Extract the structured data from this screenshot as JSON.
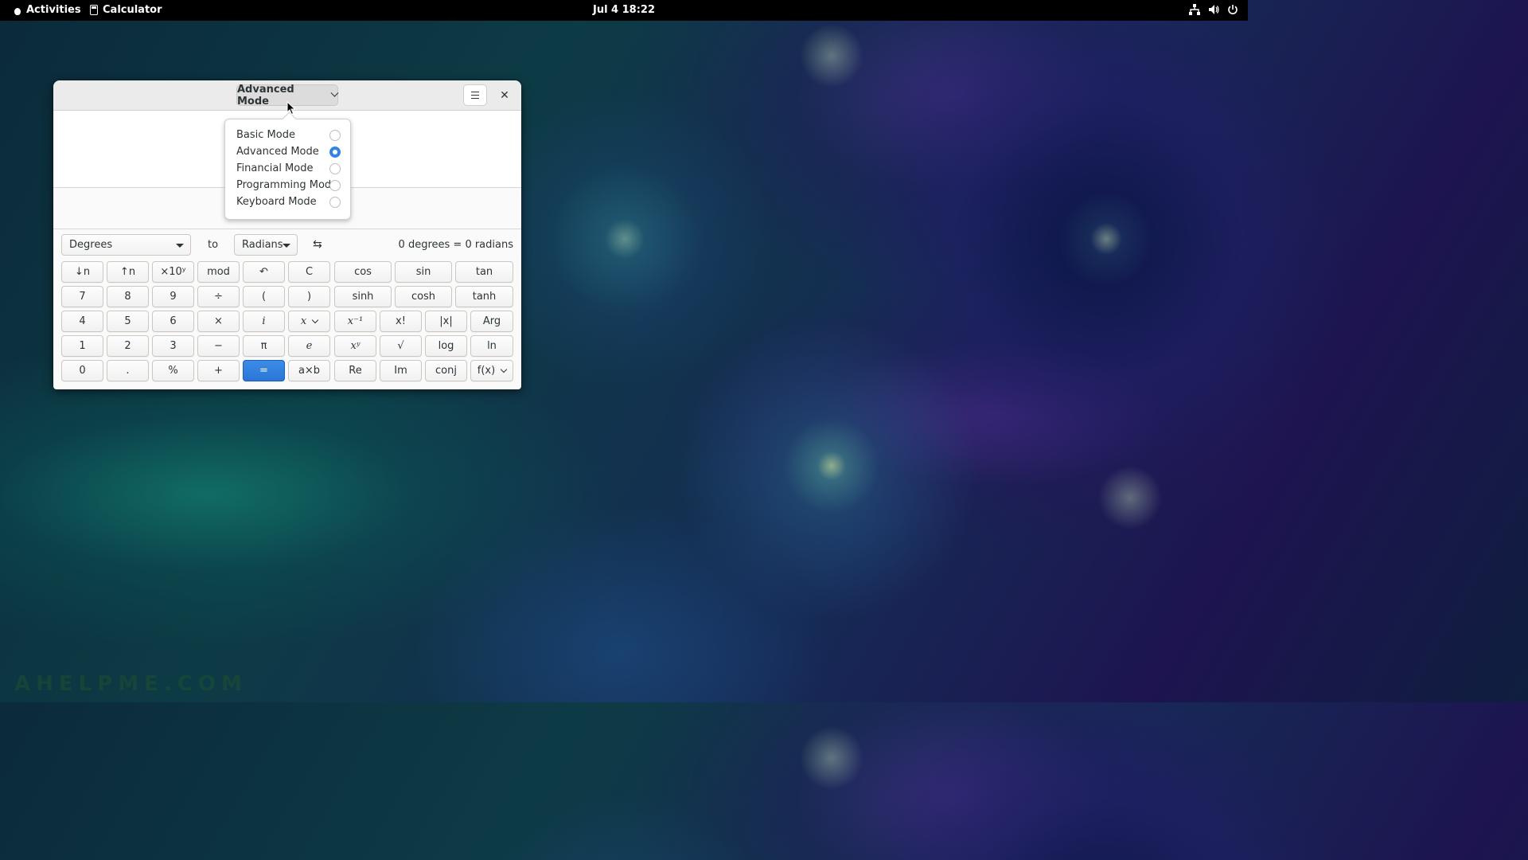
{
  "topbar": {
    "activities": "Activities",
    "app_name": "Calculator",
    "clock": "Jul 4  18:22",
    "tray_icons": [
      "network-icon",
      "volume-icon",
      "power-icon"
    ]
  },
  "window": {
    "mode_button": "Advanced Mode",
    "menu_icon": "hamburger-menu-icon",
    "close_label": "✕"
  },
  "mode_menu": {
    "items": [
      {
        "label": "Basic Mode",
        "selected": false
      },
      {
        "label": "Advanced Mode",
        "selected": true
      },
      {
        "label": "Financial Mode",
        "selected": false
      },
      {
        "label": "Programming Mode",
        "selected": false
      },
      {
        "label": "Keyboard Mode",
        "selected": false
      }
    ]
  },
  "conversion": {
    "from_unit": "Degrees",
    "to_label": "to",
    "to_unit": "Radians",
    "swap_icon": "⇆",
    "result": "0 degrees  =  0 radians"
  },
  "keypad": {
    "row1": [
      "↓n",
      "↑n",
      "×10ʸ",
      "mod",
      "↶",
      "C",
      "cos",
      "sin",
      "tan"
    ],
    "row2": [
      "7",
      "8",
      "9",
      "÷",
      "(",
      ")",
      "sinh",
      "cosh",
      "tanh"
    ],
    "row3": [
      "4",
      "5",
      "6",
      "×",
      "i",
      "x",
      "x⁻¹",
      "x!",
      "|x|",
      "Arg"
    ],
    "row4": [
      "1",
      "2",
      "3",
      "−",
      "π",
      "e",
      "xʸ",
      "√",
      "log",
      "ln"
    ],
    "row5": [
      "0",
      ".",
      "%",
      "+",
      "=",
      "a×b",
      "Re",
      "Im",
      "conj",
      "f(x)"
    ]
  },
  "watermark": "AHELPME.COM",
  "colors": {
    "accent": "#3584e4",
    "topbar": "#000000",
    "headerbar": "#ebebeb"
  }
}
